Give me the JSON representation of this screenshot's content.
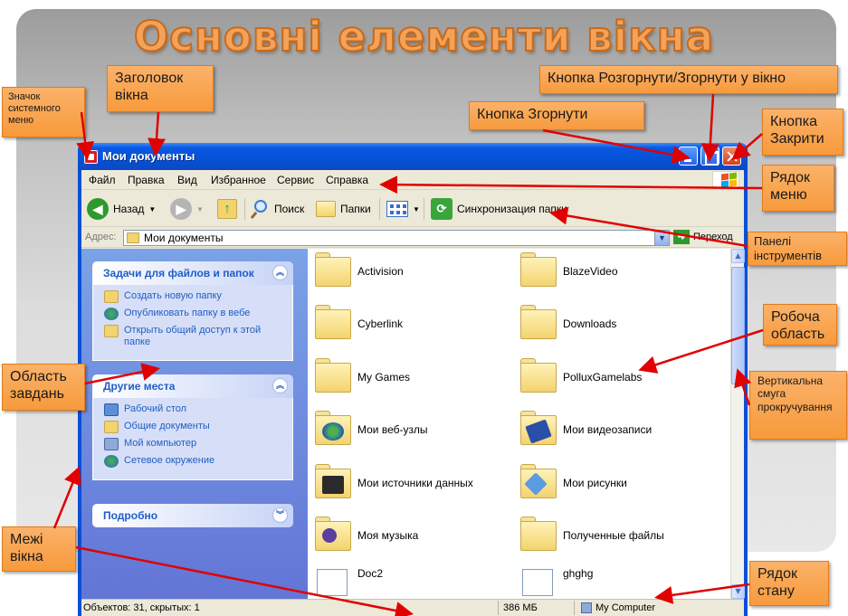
{
  "slide": {
    "title": "Основні елементи вікна"
  },
  "window": {
    "title": "Мои документы",
    "menu": [
      "Файл",
      "Правка",
      "Вид",
      "Избранное",
      "Сервис",
      "Справка"
    ],
    "toolbar": {
      "back": "Назад",
      "search": "Поиск",
      "folders": "Папки",
      "sync": "Синхронизация папки"
    },
    "address": {
      "label": "Адрес:",
      "value": "Мои документы",
      "go": "Переход"
    },
    "tasks": {
      "file_tasks": {
        "title": "Задачи для файлов и папок",
        "links": [
          "Создать новую папку",
          "Опубликовать папку в вебе",
          "Открыть общий доступ к этой папке"
        ]
      },
      "other_places": {
        "title": "Другие места",
        "links": [
          "Рабочий стол",
          "Общие документы",
          "Мой компьютер",
          "Сетевое окружение"
        ]
      },
      "details": {
        "title": "Подробно"
      }
    },
    "files": [
      "Activision",
      "BlazeVideo",
      "Cyberlink",
      "Downloads",
      "My Games",
      "PolluxGamelabs",
      "Мои веб-узлы",
      "Мои видеозаписи",
      "Мои источники данных",
      "Мои рисунки",
      "Моя музыка",
      "Полученные файлы",
      "Doc2",
      "ghghg"
    ],
    "status": {
      "objects": "Объектов: 31, скрытых: 1",
      "size": "386 МБ",
      "location": "My Computer"
    }
  },
  "callouts": {
    "sysicon": "Значок системного меню",
    "title": "Заголовок вікна",
    "maximize": "Кнопка Розгорнути/Згорнути у вікно",
    "minimize": "Кнопка Згорнути",
    "close": "Кнопка Закрити",
    "menu": "Рядок меню",
    "toolbar": "Панелі інструментів",
    "workarea": "Робоча область",
    "taskarea": "Область завдань",
    "scrollbar": "Вертикальна смуга прокручування",
    "borders": "Межі вікна",
    "status": "Рядок стану"
  },
  "colors": {
    "callout": "#f79a3c",
    "arrow": "#e00000",
    "titlebar": "#0552d6",
    "title_text": "#f4a259"
  }
}
